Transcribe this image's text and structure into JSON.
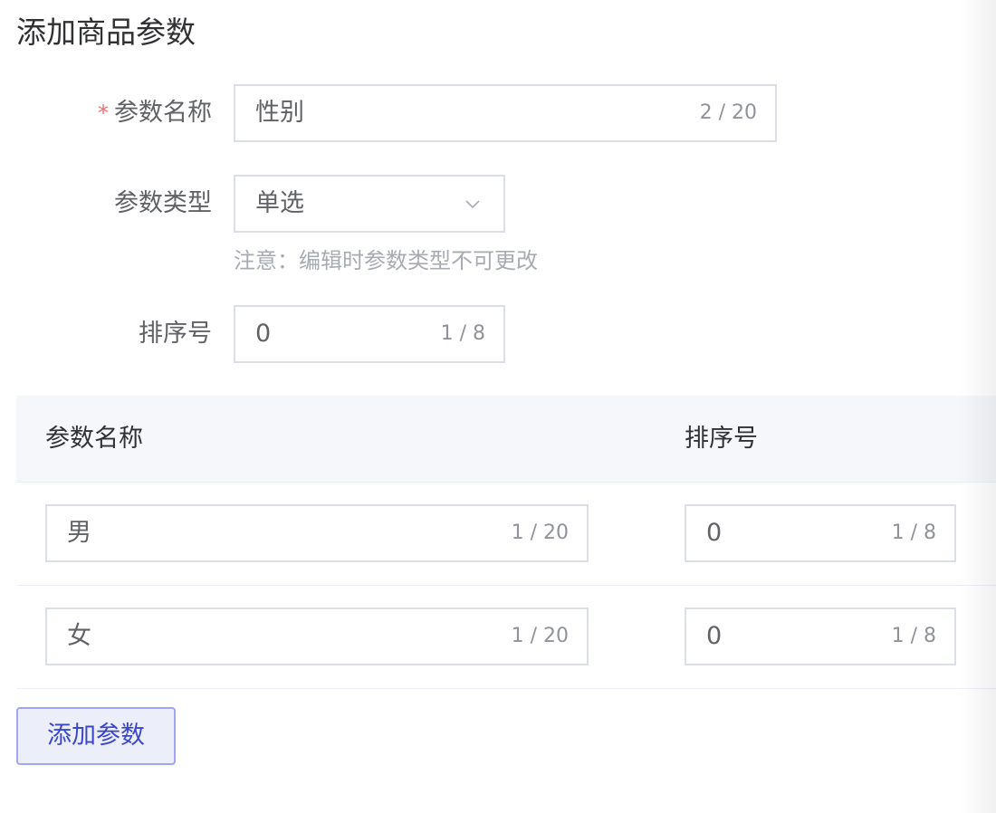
{
  "page": {
    "title": "添加商品参数"
  },
  "form": {
    "param_name": {
      "label": "参数名称",
      "required_mark": "*",
      "value": "性别",
      "count": "2 / 20"
    },
    "param_type": {
      "label": "参数类型",
      "value": "单选",
      "hint": "注意：编辑时参数类型不可更改"
    },
    "sort_number": {
      "label": "排序号",
      "value": "0",
      "count": "1 / 8"
    }
  },
  "table": {
    "headers": [
      "参数名称",
      "排序号"
    ],
    "rows": [
      {
        "name": "男",
        "name_count": "1 / 20",
        "sort": "0",
        "sort_count": "1 / 8"
      },
      {
        "name": "女",
        "name_count": "1 / 20",
        "sort": "0",
        "sort_count": "1 / 8"
      }
    ]
  },
  "actions": {
    "add_param_label": "添加参数"
  },
  "icons": {
    "select_arrow": "chevron-down-icon"
  },
  "colors": {
    "required": "#f56c6c",
    "primary_text": "#3a47c9",
    "button_bg": "#eceef9",
    "button_border": "#a0a7f0",
    "table_header_bg": "#f5f7fa"
  }
}
